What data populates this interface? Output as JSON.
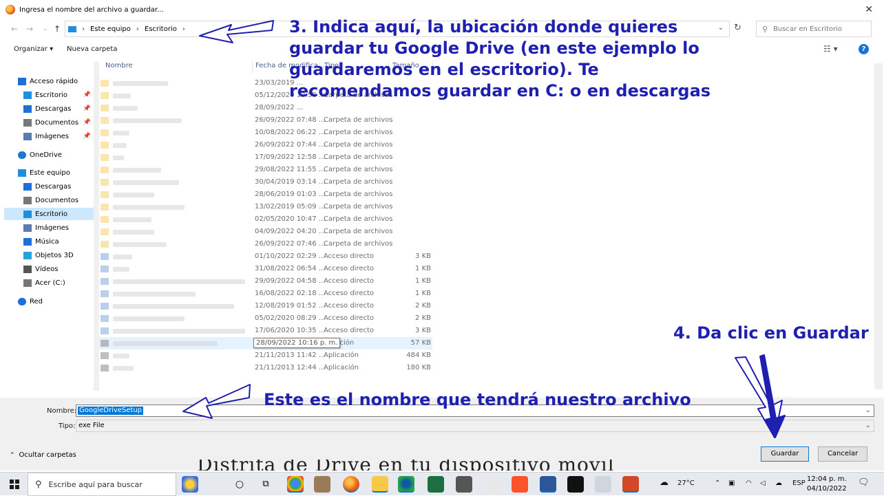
{
  "dialog": {
    "title": "Ingresa el nombre del archivo a guardar...",
    "breadcrumb": [
      "Este equipo",
      "Escritorio"
    ],
    "search_placeholder": "Buscar en Escritorio",
    "toolbar": {
      "organize": "Organizar",
      "new_folder": "Nueva carpeta"
    },
    "columns": {
      "name": "Nombre",
      "date": "Fecha de modifica...",
      "type": "Tipo",
      "size": "Tamaño"
    },
    "sidebar": [
      {
        "label": "Acceso rápido",
        "icon": "star-icon"
      },
      {
        "label": "Escritorio",
        "icon": "desktop-icon",
        "pinned": true
      },
      {
        "label": "Descargas",
        "icon": "download-icon",
        "pinned": true
      },
      {
        "label": "Documentos",
        "icon": "document-icon",
        "pinned": true
      },
      {
        "label": "Imágenes",
        "icon": "images-icon",
        "pinned": true
      },
      {
        "label": "OneDrive",
        "icon": "cloud-icon"
      },
      {
        "label": "Este equipo",
        "icon": "pc-icon"
      },
      {
        "label": "Descargas",
        "icon": "download-icon"
      },
      {
        "label": "Documentos",
        "icon": "document-icon"
      },
      {
        "label": "Escritorio",
        "icon": "desktop-icon",
        "selected": true
      },
      {
        "label": "Imágenes",
        "icon": "images-icon"
      },
      {
        "label": "Música",
        "icon": "music-icon"
      },
      {
        "label": "Objetos 3D",
        "icon": "cube-icon"
      },
      {
        "label": "Vídeos",
        "icon": "video-icon"
      },
      {
        "label": "Acer (C:)",
        "icon": "drive-icon"
      },
      {
        "label": "Red",
        "icon": "network-icon"
      }
    ],
    "files": [
      {
        "date": "23/03/2019 ...",
        "type": "",
        "size": "",
        "kind": "folder"
      },
      {
        "date": "05/12/2020 12:58 ...",
        "type": "Carpeta de archivos",
        "size": "",
        "kind": "folder"
      },
      {
        "date": "28/09/2022 ...",
        "type": "",
        "size": "",
        "kind": "folder"
      },
      {
        "date": "26/09/2022 07:48 ...",
        "type": "Carpeta de archivos",
        "size": "",
        "kind": "folder"
      },
      {
        "date": "10/08/2022 06:22 ...",
        "type": "Carpeta de archivos",
        "size": "",
        "kind": "folder"
      },
      {
        "date": "26/09/2022 07:44 ...",
        "type": "Carpeta de archivos",
        "size": "",
        "kind": "folder"
      },
      {
        "date": "17/09/2022 12:58 ...",
        "type": "Carpeta de archivos",
        "size": "",
        "kind": "folder"
      },
      {
        "date": "29/08/2022 11:55 ...",
        "type": "Carpeta de archivos",
        "size": "",
        "kind": "folder"
      },
      {
        "date": "30/04/2019 03:14 ...",
        "type": "Carpeta de archivos",
        "size": "",
        "kind": "folder"
      },
      {
        "date": "28/06/2019 01:03 ...",
        "type": "Carpeta de archivos",
        "size": "",
        "kind": "folder"
      },
      {
        "date": "13/02/2019 05:09 ...",
        "type": "Carpeta de archivos",
        "size": "",
        "kind": "folder"
      },
      {
        "date": "02/05/2020 10:47 ...",
        "type": "Carpeta de archivos",
        "size": "",
        "kind": "folder"
      },
      {
        "date": "04/09/2022 04:20 ...",
        "type": "Carpeta de archivos",
        "size": "",
        "kind": "folder"
      },
      {
        "date": "26/09/2022 07:46 ...",
        "type": "Carpeta de archivos",
        "size": "",
        "kind": "folder"
      },
      {
        "date": "01/10/2022 02:29 ...",
        "type": "Acceso directo",
        "size": "3 KB",
        "kind": "shortcut"
      },
      {
        "date": "31/08/2022 06:54 ...",
        "type": "Acceso directo",
        "size": "1 KB",
        "kind": "shortcut"
      },
      {
        "date": "29/09/2022 04:58 ...",
        "type": "Acceso directo",
        "size": "1 KB",
        "kind": "shortcut"
      },
      {
        "date": "16/08/2022 02:18 ...",
        "type": "Acceso directo",
        "size": "1 KB",
        "kind": "shortcut"
      },
      {
        "date": "12/08/2019 01:52 ...",
        "type": "Acceso directo",
        "size": "2 KB",
        "kind": "shortcut"
      },
      {
        "date": "05/02/2020 08:29 ...",
        "type": "Acceso directo",
        "size": "2 KB",
        "kind": "shortcut"
      },
      {
        "date": "17/06/2020 10:35 ...",
        "type": "Acceso directo",
        "size": "3 KB",
        "kind": "shortcut"
      },
      {
        "date": "",
        "type": "plicación",
        "size": "57 KB",
        "kind": "app",
        "hover": true
      },
      {
        "date": "21/11/2013 11:42 ...",
        "type": "Aplicación",
        "size": "484 KB",
        "kind": "app"
      },
      {
        "date": "21/11/2013 12:44 ...",
        "type": "Aplicación",
        "size": "180 KB",
        "kind": "app"
      }
    ],
    "tooltip": "28/09/2022 10:16 p. m.",
    "filename_label": "Nombre:",
    "filename_value": "GoogleDriveSetup",
    "type_label": "Tipo:",
    "type_value": "exe File",
    "hide_folders": "Ocultar carpetas",
    "save_button": "Guardar",
    "cancel_button": "Cancelar"
  },
  "annotations": {
    "step3": [
      "3. Indica aquí, la ubicación donde quieres",
      "guardar tu Google Drive (en este ejemplo lo",
      "guardaremos en el escritorio). Te",
      "recomendamos guardar en C: o en descargas"
    ],
    "step4": "4. Da clic en Guardar",
    "filename_note": "Este es el nombre que tendrá nuestro archivo",
    "color": "#1f1fb0"
  },
  "background_text": "Distrita de Drive en tu dispositivo movil",
  "taskbar": {
    "search_placeholder": "Escribe aquí para buscar",
    "weather": "27°C",
    "language": "ESP",
    "time": "12:04 p. m.",
    "date": "04/10/2022"
  }
}
